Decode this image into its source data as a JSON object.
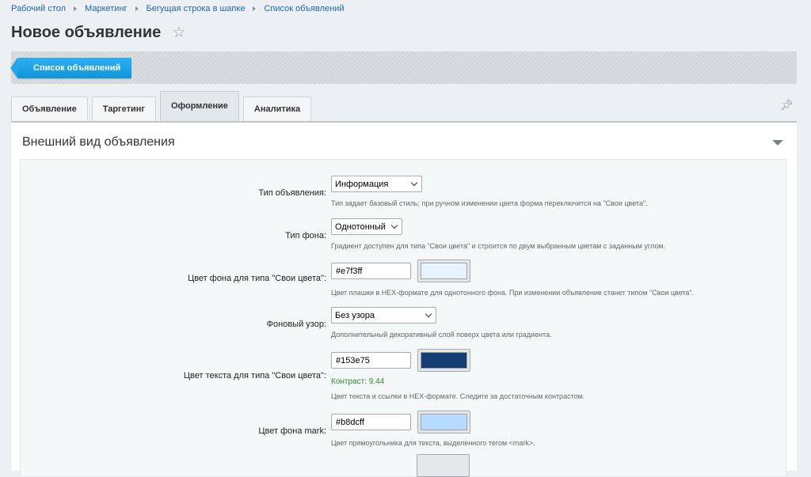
{
  "breadcrumbs": [
    "Рабочий стол",
    "Маркетинг",
    "Бегущая строка в шапке",
    "Список объявлений"
  ],
  "page_title": "Новое объявление",
  "toolbar": {
    "list_button": "Список объявлений"
  },
  "tabs": [
    "Объявление",
    "Таргетинг",
    "Оформление",
    "Аналитика"
  ],
  "active_tab": "Оформление",
  "section_title": "Внешний вид объявления",
  "fields": {
    "ad_type": {
      "label": "Тип объявления:",
      "value": "Информация",
      "hint": "Тип задает базовый стиль; при ручном изменении цвета форма переключится на \"Свои цвета\"."
    },
    "bg_type": {
      "label": "Тип фона:",
      "value": "Однотонный",
      "hint": "Градиент доступен для типа \"Свои цвета\" и строится по двум выбранным цветам с заданным углом."
    },
    "bg_color": {
      "label": "Цвет фона для типа \"Свои цвета\":",
      "value": "#e7f3ff",
      "swatch": "#e7f3ff",
      "hint": "Цвет плашки в HEX-формате для однотонного фона. При изменении объявление станет типом \"Свои цвета\"."
    },
    "pattern": {
      "label": "Фоновый узор:",
      "value": "Без узора",
      "hint": "Дополнительный декоративный слой поверх цвета или градиента."
    },
    "text_color": {
      "label": "Цвет текста для типа \"Свои цвета\":",
      "value": "#153e75",
      "swatch": "#153e75",
      "contrast": "Контраст: 9.44",
      "hint": "Цвет текста и ссылки в HEX-формате. Следите за достаточным контрастом."
    },
    "mark_color": {
      "label": "Цвет фона mark:",
      "value": "#b8dcff",
      "swatch": "#b8dcff",
      "hint": "Цвет прямоугольника для текста, выделенного тегом <mark>."
    }
  },
  "colors": {
    "accent": "#1aa3e8",
    "link": "#2067b0",
    "contrast_ok": "#2b8a2b"
  }
}
